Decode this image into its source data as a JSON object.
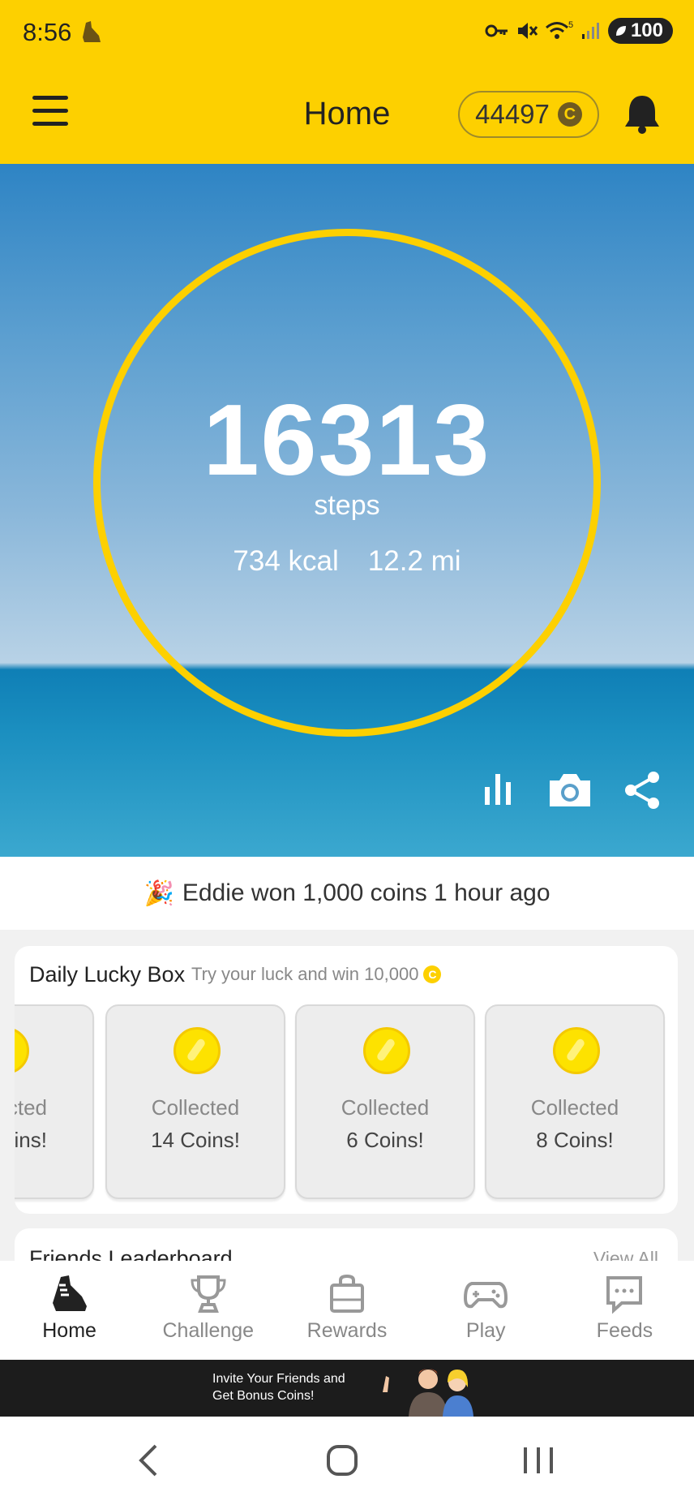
{
  "status_bar": {
    "time": "8:56",
    "battery": "100",
    "wifi_badge": "5"
  },
  "header": {
    "title": "Home",
    "coins": "44497",
    "coin_symbol": "C"
  },
  "hero": {
    "steps": "16313",
    "steps_unit": "steps",
    "kcal": "734 kcal",
    "distance": "12.2 mi"
  },
  "winner_banner": {
    "emoji": "🎉",
    "text": "Eddie won 1,000 coins 1 hour ago"
  },
  "lucky_box": {
    "title": "Daily Lucky Box",
    "subtitle": "Try your luck and win 10,000",
    "coin_symbol": "C",
    "boxes": [
      {
        "status": "cted",
        "reward": "ins!"
      },
      {
        "status": "Collected",
        "reward": "14 Coins!"
      },
      {
        "status": "Collected",
        "reward": "6 Coins!"
      },
      {
        "status": "Collected",
        "reward": "8 Coins!"
      }
    ]
  },
  "leaderboard": {
    "title": "Friends Leaderboard",
    "view_all": "View All"
  },
  "bottom_nav": [
    {
      "label": "Home",
      "icon": "shoe-icon",
      "active": true
    },
    {
      "label": "Challenge",
      "icon": "trophy-icon",
      "active": false
    },
    {
      "label": "Rewards",
      "icon": "shopping-bag-icon",
      "active": false
    },
    {
      "label": "Play",
      "icon": "gamepad-icon",
      "active": false
    },
    {
      "label": "Feeds",
      "icon": "chat-bubble-icon",
      "active": false
    }
  ],
  "invite_banner": {
    "line1": "Invite Your Friends and",
    "line2": "Get Bonus Coins!"
  },
  "colors": {
    "brand_yellow": "#fdd000",
    "text_dark": "#222222",
    "text_muted": "#888888"
  }
}
